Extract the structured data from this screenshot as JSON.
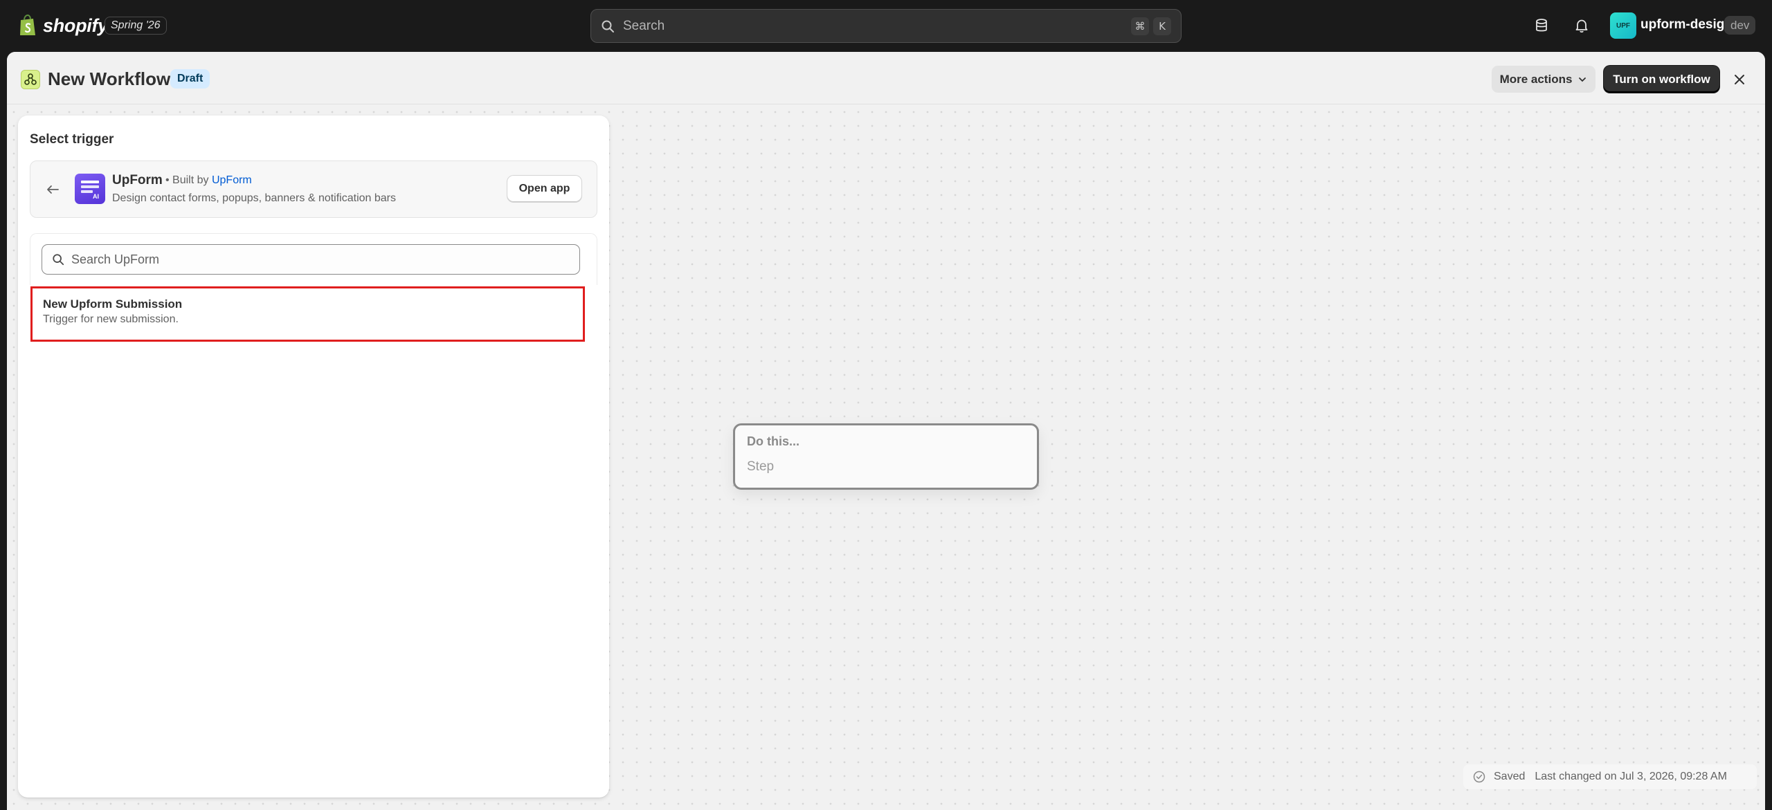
{
  "topbar": {
    "brand": "shopify",
    "edition": "Spring '26",
    "search_placeholder": "Search",
    "shortcut_keys": [
      "⌘",
      "K"
    ],
    "store_initials": "UPF",
    "store_name": "upform-design",
    "env_badge": "dev",
    "icons": [
      "database-icon",
      "bell-icon"
    ]
  },
  "header": {
    "title": "New Workflow",
    "status_badge": "Draft",
    "more_actions_label": "More actions",
    "primary_label": "Turn on workflow"
  },
  "panel": {
    "title": "Select trigger",
    "app": {
      "name": "UpForm",
      "built_by_prefix": "• Built by",
      "developer": "UpForm",
      "description": "Design contact forms, popups, banners & notification bars",
      "open_label": "Open app"
    },
    "search_placeholder": "Search UpForm",
    "triggers": [
      {
        "name": "New Upform Submission",
        "description": "Trigger for new submission."
      }
    ]
  },
  "canvas": {
    "step_title": "Do this...",
    "step_placeholder": "Step"
  },
  "status": {
    "saved": "Saved",
    "last_changed": "Last changed on Jul 3, 2026, 09:28 AM"
  },
  "colors": {
    "topbar_bg": "#1a1a1a",
    "primary_button": "#303030",
    "draft_badge_bg": "#d5ebff",
    "highlight_border": "#e01e1e",
    "link": "#005bd3"
  }
}
